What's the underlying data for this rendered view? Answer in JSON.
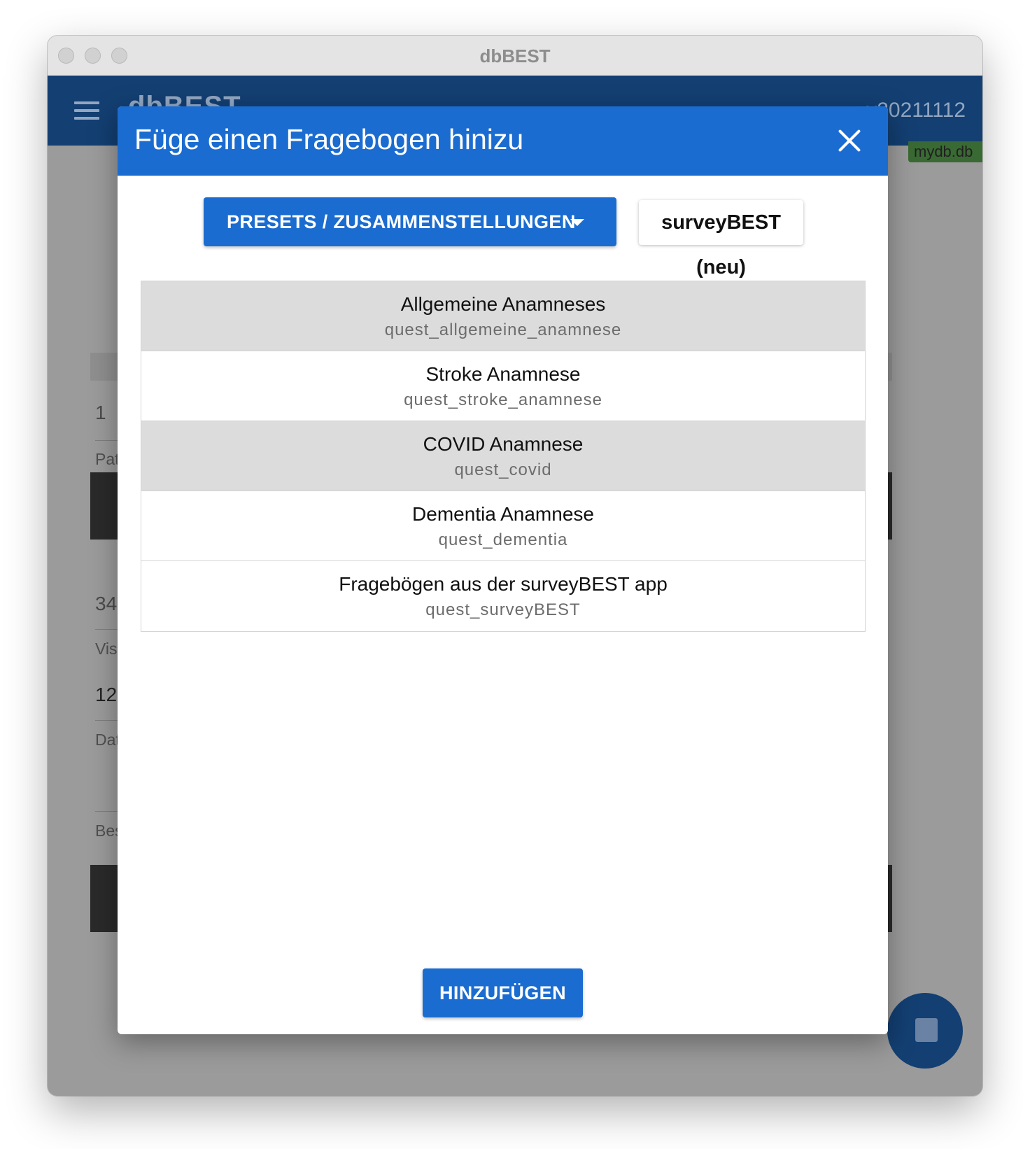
{
  "window": {
    "title": "dbBEST"
  },
  "app": {
    "title": "dbBEST",
    "version": "v20211112",
    "db_file": "mydb.db"
  },
  "background": {
    "field_value_1": "1",
    "label_1": "Pat",
    "field_value_2": "34",
    "label_2": "Vis",
    "field_value_3": "12",
    "label_3": "Dat",
    "label_4": "Bes"
  },
  "dialog": {
    "title": "Füge einen Fragebogen hinizu",
    "presets_button": "PRESETS / ZUSAMMENSTELLUNGEN",
    "survey_button": "surveyBEST (neu)",
    "add_button": "HINZUFÜGEN",
    "questionnaires": [
      {
        "name": "Allgemeine Anamneses",
        "id": "quest_allgemeine_anamnese",
        "selected": true
      },
      {
        "name": "Stroke Anamnese",
        "id": "quest_stroke_anamnese",
        "selected": false
      },
      {
        "name": "COVID Anamnese",
        "id": "quest_covid",
        "selected": true
      },
      {
        "name": "Dementia Anamnese",
        "id": "quest_dementia",
        "selected": false
      },
      {
        "name": "Fragebögen aus der surveyBEST app",
        "id": "quest_surveyBEST",
        "selected": false
      }
    ]
  },
  "colors": {
    "primary": "#1b6cd0",
    "appbar": "#133f72",
    "selected_row": "#dcdcdc"
  },
  "icons": [
    "hamburger-menu-icon",
    "close-icon",
    "dropdown-caret-icon",
    "save-icon"
  ]
}
